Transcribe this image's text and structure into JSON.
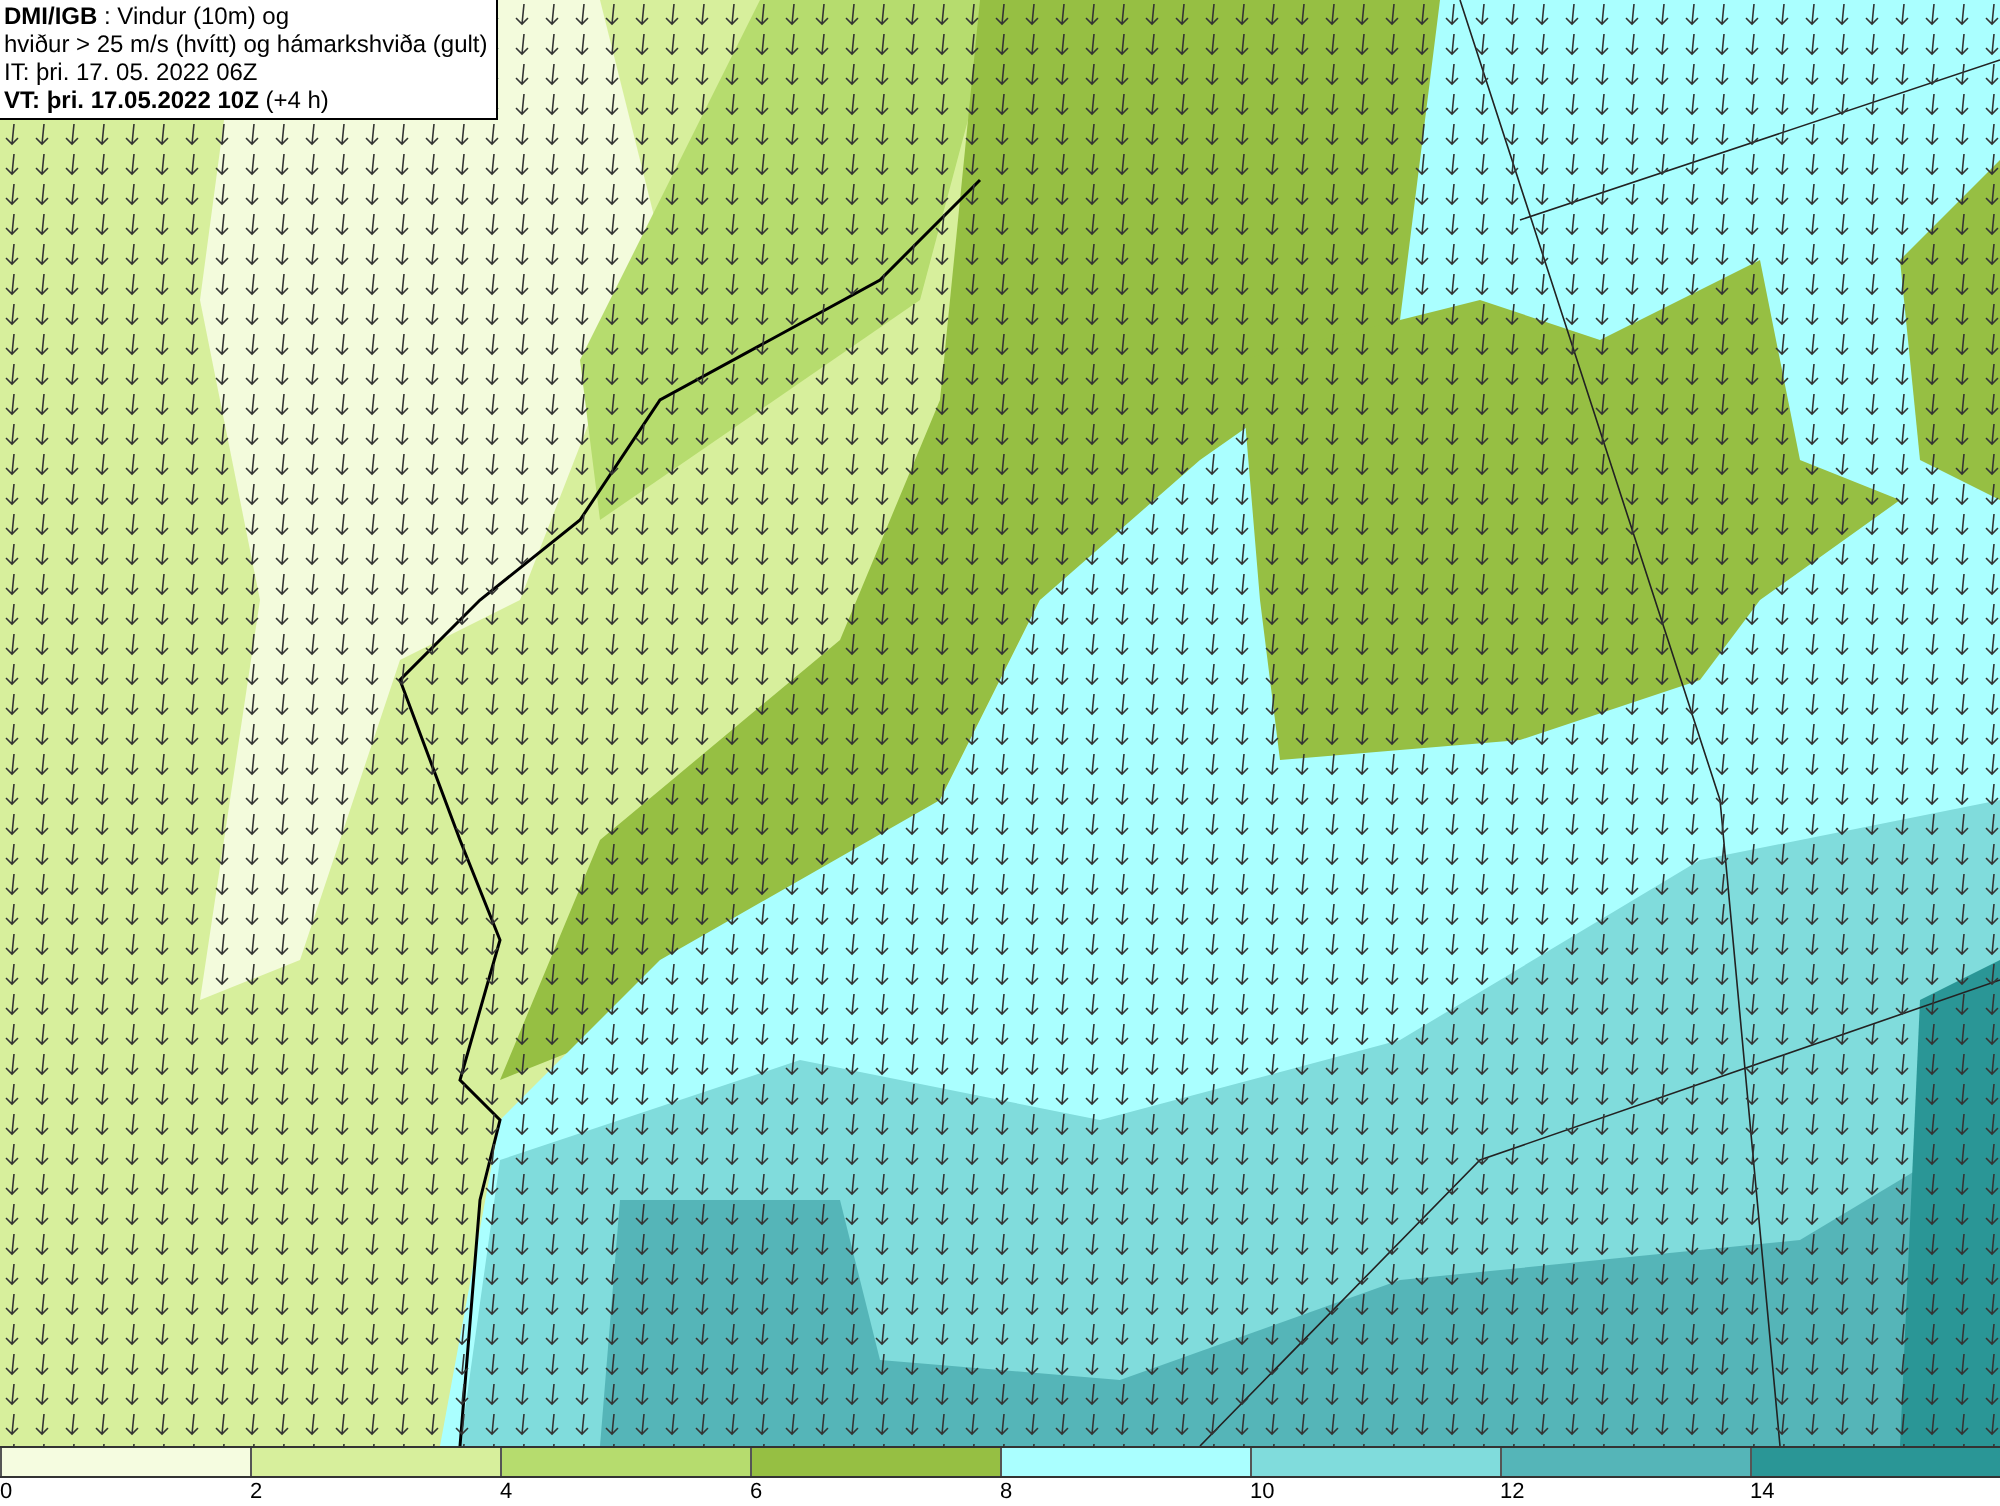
{
  "header": {
    "lines": [
      "**DMI/IGB** : Vindur (10m) og",
      "hviður > 25 m/s (hvítt) og hámarkshviða (gult)",
      "IT: þri. 17. 05. 2022 06Z",
      "**VT: þri. 17.05.2022 10Z** (+4 h)"
    ]
  },
  "legend": {
    "bins": [
      {
        "color": "#f5fce0"
      },
      {
        "color": "#d7ef9c"
      },
      {
        "color": "#b6dc6e"
      },
      {
        "color": "#96bf43"
      },
      {
        "color": "#aaffff"
      },
      {
        "color": "#80dcdc"
      },
      {
        "color": "#55b5b8"
      },
      {
        "color": "#2a9696"
      }
    ],
    "ticks": [
      "0",
      "2",
      "4",
      "6",
      "8",
      "10",
      "12",
      "14"
    ]
  }
}
